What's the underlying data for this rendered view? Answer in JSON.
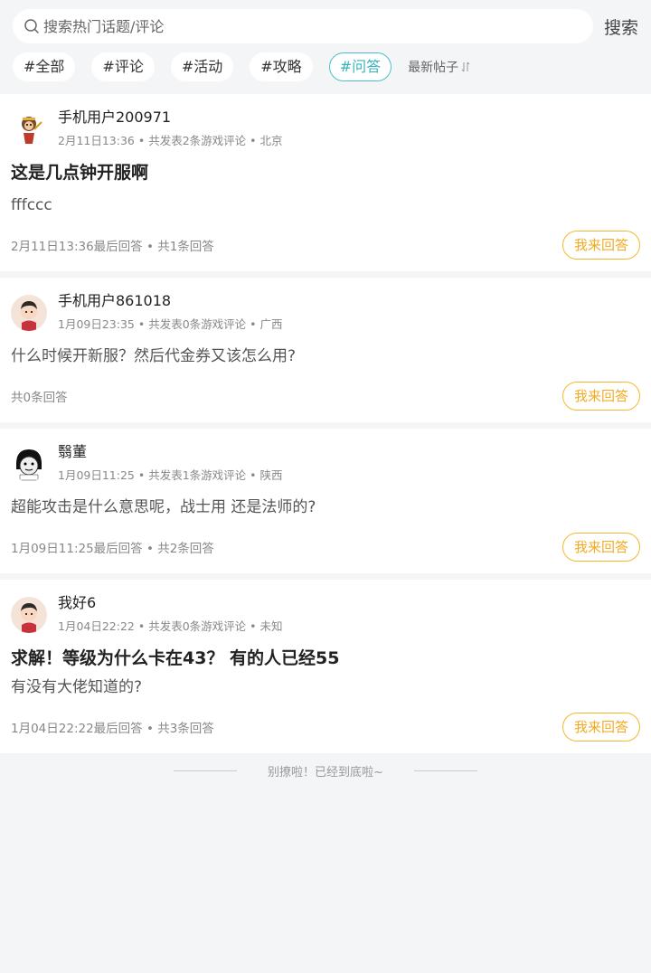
{
  "search": {
    "placeholder": "搜索热门话题/评论",
    "button_label": "搜索"
  },
  "tags": [
    {
      "label": "#全部",
      "active": false
    },
    {
      "label": "#评论",
      "active": false
    },
    {
      "label": "#活动",
      "active": false
    },
    {
      "label": "#攻略",
      "active": false
    },
    {
      "label": "#问答",
      "active": true
    }
  ],
  "sort": {
    "label": "最新帖子",
    "icon": "sort-arrows-icon"
  },
  "posts": [
    {
      "user": "手机用户200971",
      "meta": "2月11日13:36 • 共发表2条游戏评论 • 北京",
      "title": "这是几点钟开服啊",
      "content": "fffccc",
      "footer": "2月11日13:36最后回答 • 共1条回答",
      "answer_label": "我来回答",
      "avatar": "monkey-avatar"
    },
    {
      "user": "手机用户861018",
      "meta": "1月09日23:35 • 共发表0条游戏评论 • 广西",
      "title": "",
      "content": "什么时候开新服？然后代金券又该怎么用?",
      "footer": "共0条回答",
      "answer_label": "我来回答",
      "avatar": "boy-avatar"
    },
    {
      "user": "翳董",
      "meta": "1月09日11:25 • 共发表1条游戏评论 • 陕西",
      "title": "",
      "content": "超能攻击是什么意思呢，战士用 还是法师的?",
      "footer": "1月09日11:25最后回答 • 共2条回答",
      "answer_label": "我来回答",
      "avatar": "meme-avatar"
    },
    {
      "user": "我好6",
      "meta": "1月04日22:22 • 共发表0条游戏评论 • 未知",
      "title": "求解！等级为什么卡在43？ 有的人已经55",
      "content": "有没有大佬知道的?",
      "footer": "1月04日22:22最后回答 • 共3条回答",
      "answer_label": "我来回答",
      "avatar": "boy-avatar"
    }
  ],
  "end_text": "别撩啦！已经到底啦~",
  "colors": {
    "accent_teal": "#38b2bb",
    "answer_orange": "#f2ab22",
    "background": "#f4f5f7"
  }
}
